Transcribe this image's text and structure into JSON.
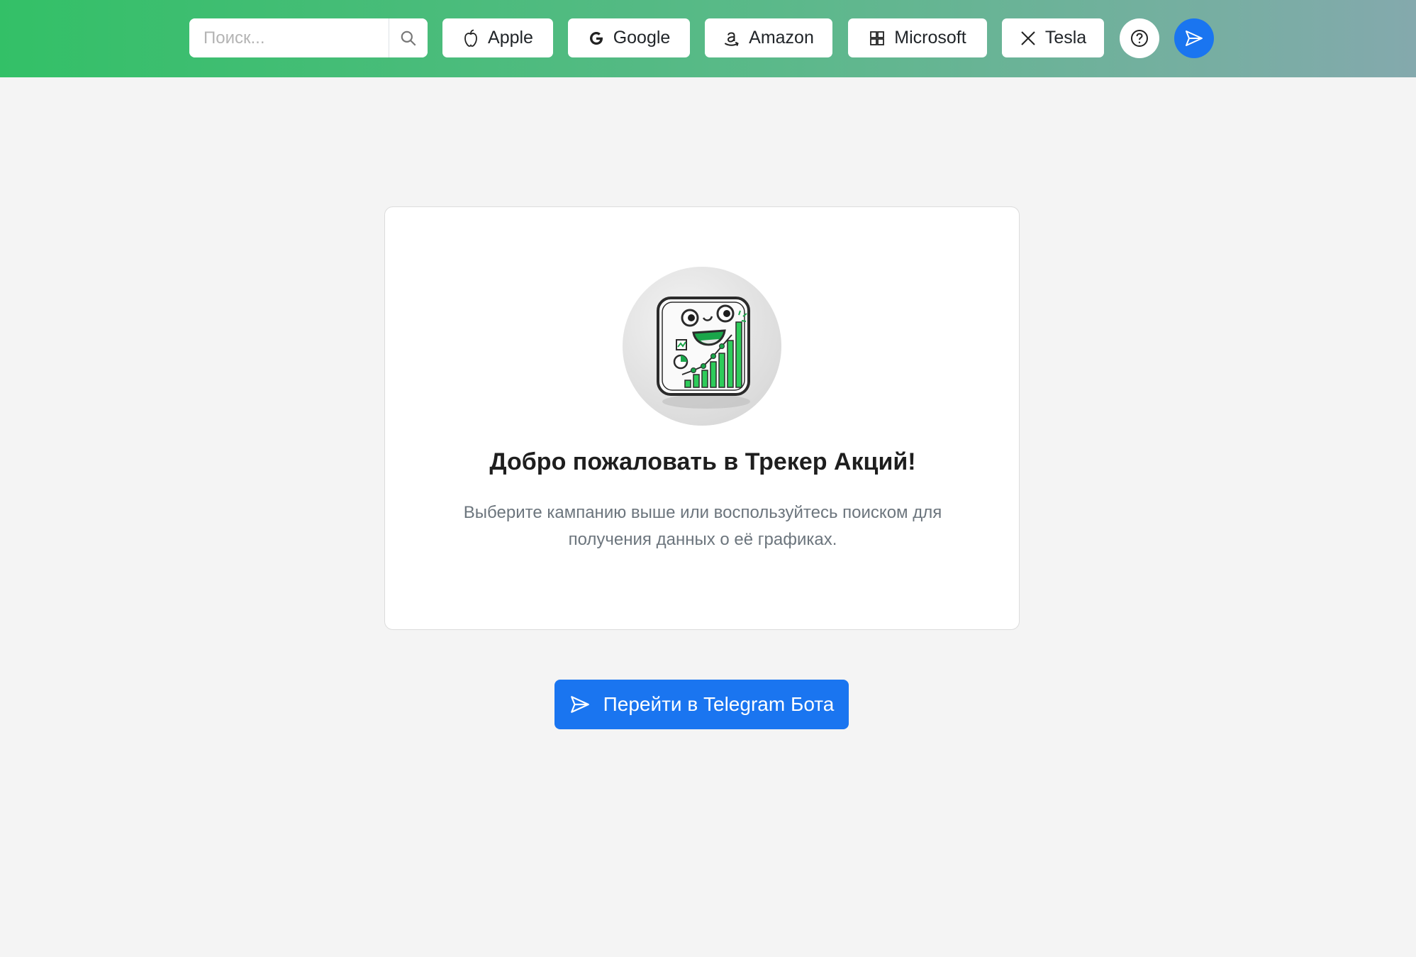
{
  "header": {
    "search": {
      "placeholder": "Поиск...",
      "value": ""
    },
    "companies": [
      {
        "label": "Apple",
        "icon": "apple-icon"
      },
      {
        "label": "Google",
        "icon": "google-icon"
      },
      {
        "label": "Amazon",
        "icon": "amazon-icon"
      },
      {
        "label": "Microsoft",
        "icon": "microsoft-icon"
      },
      {
        "label": "Tesla",
        "icon": "x-icon"
      }
    ],
    "help_icon": "question-circle-icon",
    "telegram_icon": "send-icon",
    "gradient": [
      "#33c067",
      "#84a9ad"
    ]
  },
  "welcome": {
    "title": "Добро пожаловать в Трекер Акций!",
    "text": "Выберите кампанию выше или воспользуйтесь поиском для получения данных о её графиках.",
    "mascot": "chart-mascot-icon"
  },
  "cta": {
    "label": "Перейти в Telegram Бота",
    "color": "#1a75f0",
    "icon": "send-icon"
  }
}
